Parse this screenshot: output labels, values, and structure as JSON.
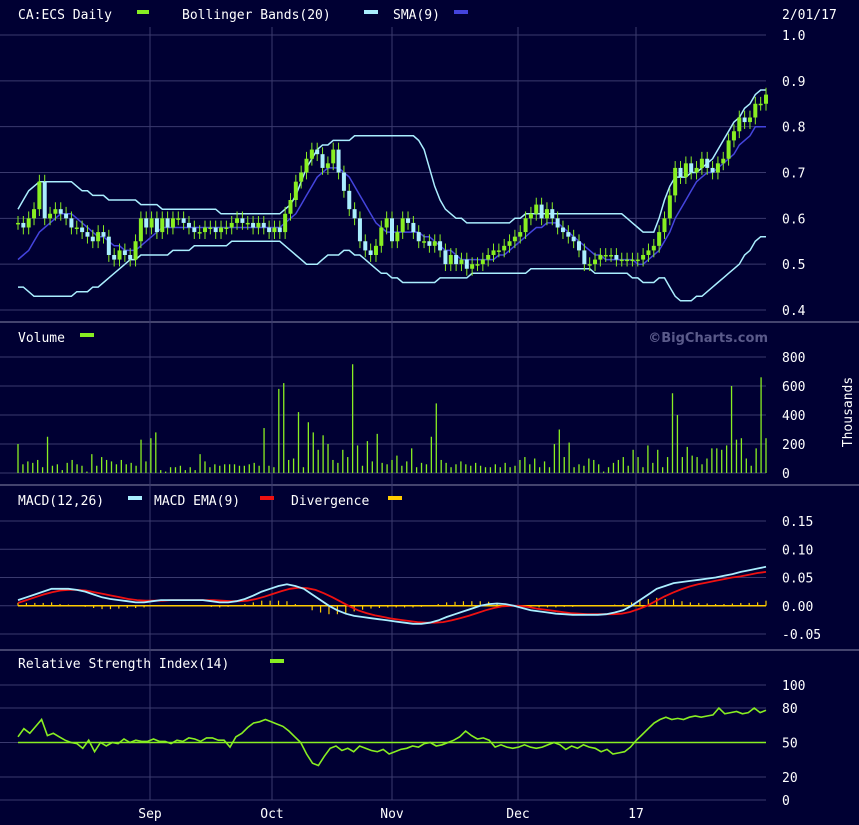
{
  "colors": {
    "background": "#000033",
    "grid": "#3a3a6e",
    "text": "#ffffff",
    "price": "#88ee22",
    "bollinger": "#aaeeff",
    "sma": "#4444dd",
    "volume": "#88ee22",
    "macd": "#aaeeff",
    "macd_ema": "#ee1111",
    "divergence": "#ffcc00",
    "rsi": "#88ee22"
  },
  "header": {
    "symbol_label": "CA:ECS Daily",
    "bollinger_label": "Bollinger Bands(20)",
    "sma_label": "SMA(9)",
    "date": "2/01/17"
  },
  "watermark": "©BigCharts.com",
  "x_labels": [
    "Sep",
    "Oct",
    "Nov",
    "Dec",
    "17"
  ],
  "chart_data": [
    {
      "type": "candlestick",
      "title": "CA:ECS Daily",
      "ylim": [
        0.4,
        1.0
      ],
      "yticks": [
        "1.0",
        "0.9",
        "0.8",
        "0.7",
        "0.6",
        "0.5",
        "0.4"
      ],
      "ytick_values": [
        1.0,
        0.9,
        0.8,
        0.7,
        0.6,
        0.5,
        0.4
      ],
      "close": [
        0.59,
        0.58,
        0.6,
        0.62,
        0.68,
        0.6,
        0.61,
        0.62,
        0.61,
        0.6,
        0.58,
        0.58,
        0.57,
        0.56,
        0.55,
        0.57,
        0.56,
        0.52,
        0.51,
        0.53,
        0.52,
        0.51,
        0.55,
        0.6,
        0.58,
        0.6,
        0.57,
        0.6,
        0.58,
        0.6,
        0.6,
        0.59,
        0.58,
        0.57,
        0.57,
        0.58,
        0.58,
        0.57,
        0.58,
        0.58,
        0.59,
        0.6,
        0.59,
        0.59,
        0.58,
        0.59,
        0.58,
        0.57,
        0.58,
        0.57,
        0.61,
        0.64,
        0.68,
        0.7,
        0.73,
        0.75,
        0.74,
        0.71,
        0.72,
        0.75,
        0.7,
        0.66,
        0.62,
        0.6,
        0.55,
        0.53,
        0.52,
        0.54,
        0.58,
        0.6,
        0.55,
        0.57,
        0.6,
        0.59,
        0.57,
        0.55,
        0.55,
        0.54,
        0.55,
        0.53,
        0.5,
        0.52,
        0.5,
        0.51,
        0.49,
        0.5,
        0.5,
        0.51,
        0.52,
        0.53,
        0.53,
        0.54,
        0.55,
        0.56,
        0.57,
        0.6,
        0.61,
        0.63,
        0.6,
        0.62,
        0.6,
        0.58,
        0.57,
        0.56,
        0.55,
        0.53,
        0.5,
        0.5,
        0.51,
        0.52,
        0.52,
        0.52,
        0.51,
        0.51,
        0.51,
        0.51,
        0.51,
        0.52,
        0.53,
        0.54,
        0.57,
        0.6,
        0.65,
        0.71,
        0.69,
        0.72,
        0.7,
        0.71,
        0.73,
        0.71,
        0.7,
        0.72,
        0.73,
        0.77,
        0.79,
        0.82,
        0.81,
        0.82,
        0.85,
        0.85,
        0.87
      ],
      "bollinger_upper": [
        0.62,
        0.64,
        0.66,
        0.67,
        0.68,
        0.68,
        0.68,
        0.68,
        0.68,
        0.68,
        0.68,
        0.67,
        0.66,
        0.66,
        0.65,
        0.65,
        0.65,
        0.64,
        0.64,
        0.64,
        0.64,
        0.64,
        0.64,
        0.63,
        0.63,
        0.63,
        0.63,
        0.62,
        0.62,
        0.62,
        0.62,
        0.62,
        0.62,
        0.62,
        0.62,
        0.62,
        0.62,
        0.62,
        0.61,
        0.61,
        0.61,
        0.61,
        0.61,
        0.61,
        0.61,
        0.61,
        0.61,
        0.61,
        0.61,
        0.61,
        0.62,
        0.63,
        0.65,
        0.68,
        0.71,
        0.73,
        0.75,
        0.76,
        0.76,
        0.77,
        0.77,
        0.77,
        0.77,
        0.78,
        0.78,
        0.78,
        0.78,
        0.78,
        0.78,
        0.78,
        0.78,
        0.78,
        0.78,
        0.78,
        0.78,
        0.77,
        0.75,
        0.71,
        0.67,
        0.64,
        0.62,
        0.61,
        0.6,
        0.6,
        0.59,
        0.59,
        0.59,
        0.59,
        0.59,
        0.59,
        0.59,
        0.59,
        0.59,
        0.6,
        0.6,
        0.61,
        0.61,
        0.61,
        0.61,
        0.61,
        0.61,
        0.61,
        0.61,
        0.61,
        0.61,
        0.61,
        0.61,
        0.61,
        0.61,
        0.61,
        0.61,
        0.61,
        0.61,
        0.61,
        0.6,
        0.59,
        0.58,
        0.57,
        0.57,
        0.57,
        0.6,
        0.64,
        0.67,
        0.69,
        0.69,
        0.69,
        0.7,
        0.7,
        0.71,
        0.72,
        0.73,
        0.75,
        0.77,
        0.79,
        0.81,
        0.82,
        0.84,
        0.85,
        0.87,
        0.88,
        0.88
      ],
      "bollinger_lower": [
        0.45,
        0.45,
        0.44,
        0.43,
        0.43,
        0.43,
        0.43,
        0.43,
        0.43,
        0.43,
        0.43,
        0.44,
        0.44,
        0.44,
        0.45,
        0.45,
        0.46,
        0.47,
        0.48,
        0.49,
        0.5,
        0.51,
        0.51,
        0.52,
        0.52,
        0.52,
        0.52,
        0.52,
        0.52,
        0.53,
        0.53,
        0.53,
        0.53,
        0.54,
        0.54,
        0.54,
        0.54,
        0.54,
        0.54,
        0.54,
        0.55,
        0.55,
        0.55,
        0.55,
        0.55,
        0.55,
        0.55,
        0.55,
        0.55,
        0.55,
        0.54,
        0.53,
        0.52,
        0.51,
        0.5,
        0.5,
        0.5,
        0.51,
        0.52,
        0.52,
        0.52,
        0.53,
        0.53,
        0.52,
        0.52,
        0.51,
        0.5,
        0.49,
        0.48,
        0.48,
        0.47,
        0.47,
        0.46,
        0.46,
        0.46,
        0.46,
        0.46,
        0.46,
        0.46,
        0.47,
        0.47,
        0.47,
        0.47,
        0.47,
        0.47,
        0.48,
        0.48,
        0.48,
        0.48,
        0.48,
        0.48,
        0.48,
        0.48,
        0.48,
        0.48,
        0.48,
        0.49,
        0.49,
        0.49,
        0.49,
        0.49,
        0.49,
        0.49,
        0.49,
        0.49,
        0.49,
        0.49,
        0.49,
        0.48,
        0.48,
        0.48,
        0.48,
        0.48,
        0.48,
        0.48,
        0.47,
        0.47,
        0.46,
        0.46,
        0.46,
        0.47,
        0.47,
        0.45,
        0.43,
        0.42,
        0.42,
        0.42,
        0.43,
        0.43,
        0.44,
        0.45,
        0.46,
        0.47,
        0.48,
        0.49,
        0.5,
        0.52,
        0.53,
        0.55,
        0.56,
        0.56
      ],
      "sma": [
        0.51,
        0.52,
        0.53,
        0.55,
        0.57,
        0.58,
        0.59,
        0.6,
        0.61,
        0.61,
        0.61,
        0.6,
        0.59,
        0.58,
        0.57,
        0.56,
        0.56,
        0.55,
        0.54,
        0.54,
        0.53,
        0.53,
        0.53,
        0.54,
        0.55,
        0.56,
        0.57,
        0.58,
        0.58,
        0.58,
        0.58,
        0.58,
        0.58,
        0.58,
        0.58,
        0.58,
        0.58,
        0.58,
        0.58,
        0.58,
        0.58,
        0.58,
        0.58,
        0.58,
        0.58,
        0.58,
        0.58,
        0.58,
        0.58,
        0.58,
        0.59,
        0.6,
        0.61,
        0.63,
        0.65,
        0.67,
        0.69,
        0.7,
        0.71,
        0.71,
        0.71,
        0.7,
        0.69,
        0.67,
        0.65,
        0.63,
        0.61,
        0.59,
        0.58,
        0.57,
        0.57,
        0.57,
        0.57,
        0.57,
        0.57,
        0.57,
        0.56,
        0.56,
        0.55,
        0.54,
        0.53,
        0.53,
        0.52,
        0.51,
        0.51,
        0.51,
        0.51,
        0.51,
        0.51,
        0.51,
        0.52,
        0.52,
        0.53,
        0.54,
        0.55,
        0.56,
        0.57,
        0.58,
        0.58,
        0.59,
        0.59,
        0.59,
        0.58,
        0.57,
        0.56,
        0.55,
        0.54,
        0.53,
        0.52,
        0.52,
        0.51,
        0.51,
        0.51,
        0.51,
        0.51,
        0.51,
        0.5,
        0.5,
        0.51,
        0.52,
        0.53,
        0.55,
        0.57,
        0.6,
        0.62,
        0.64,
        0.66,
        0.68,
        0.69,
        0.7,
        0.7,
        0.71,
        0.72,
        0.73,
        0.74,
        0.76,
        0.77,
        0.78,
        0.8,
        0.8,
        0.8
      ]
    },
    {
      "type": "bar",
      "title": "Volume",
      "ylabel": "Thousands",
      "ylim": [
        0,
        800
      ],
      "yticks": [
        "800",
        "600",
        "400",
        "200",
        "0"
      ],
      "ytick_values": [
        800,
        600,
        400,
        200,
        0
      ],
      "values": [
        200,
        60,
        80,
        70,
        90,
        40,
        250,
        50,
        60,
        20,
        70,
        90,
        60,
        50,
        10,
        130,
        50,
        110,
        90,
        80,
        60,
        90,
        60,
        70,
        50,
        230,
        80,
        240,
        280,
        20,
        10,
        40,
        40,
        50,
        20,
        40,
        20,
        130,
        80,
        40,
        60,
        50,
        60,
        60,
        60,
        50,
        50,
        60,
        70,
        50,
        310,
        50,
        40,
        580,
        620,
        90,
        100,
        420,
        40,
        350,
        280,
        160,
        260,
        200,
        90,
        70,
        160,
        110,
        750,
        190,
        50,
        220,
        80,
        270,
        70,
        60,
        90,
        120,
        50,
        80,
        170,
        40,
        70,
        60,
        250,
        480,
        90,
        70,
        40,
        60,
        80,
        60,
        50,
        70,
        50,
        40,
        40,
        60,
        40,
        70,
        40,
        50,
        90,
        110,
        60,
        100,
        40,
        80,
        40,
        200,
        300,
        110,
        210,
        40,
        60,
        50,
        100,
        90,
        60,
        10,
        40,
        70,
        90,
        110,
        50,
        160,
        110,
        40,
        190,
        70,
        160,
        40,
        110,
        550,
        400,
        110,
        180,
        120,
        110,
        60,
        100,
        170,
        170,
        160,
        190,
        600,
        230,
        240,
        100,
        50,
        170,
        660,
        240
      ],
      "volume_values_note_removed": true
    },
    {
      "type": "line",
      "title": "MACD(12,26)",
      "ylim": [
        -0.05,
        0.15
      ],
      "yticks": [
        "0.15",
        "0.10",
        "0.05",
        "0.00",
        "-0.05"
      ],
      "ytick_values": [
        0.15,
        0.1,
        0.05,
        0.0,
        -0.05
      ],
      "series": [
        {
          "name": "MACD(12,26)",
          "values": [
            0.01,
            0.015,
            0.02,
            0.025,
            0.03,
            0.03,
            0.03,
            0.028,
            0.025,
            0.02,
            0.015,
            0.012,
            0.01,
            0.008,
            0.006,
            0.006,
            0.008,
            0.01,
            0.01,
            0.01,
            0.01,
            0.01,
            0.01,
            0.008,
            0.006,
            0.006,
            0.008,
            0.012,
            0.018,
            0.025,
            0.03,
            0.035,
            0.038,
            0.035,
            0.03,
            0.02,
            0.01,
            0.0,
            -0.008,
            -0.014,
            -0.018,
            -0.02,
            -0.022,
            -0.024,
            -0.026,
            -0.028,
            -0.03,
            -0.032,
            -0.032,
            -0.03,
            -0.026,
            -0.02,
            -0.015,
            -0.01,
            -0.005,
            0.0,
            0.003,
            0.004,
            0.003,
            0.0,
            -0.004,
            -0.008,
            -0.01,
            -0.012,
            -0.014,
            -0.015,
            -0.016,
            -0.016,
            -0.016,
            -0.016,
            -0.015,
            -0.012,
            -0.008,
            0.0,
            0.01,
            0.02,
            0.03,
            0.035,
            0.04,
            0.042,
            0.044,
            0.046,
            0.048,
            0.05,
            0.053,
            0.056,
            0.06,
            0.063,
            0.066,
            0.069
          ]
        },
        {
          "name": "MACD EMA(9)",
          "values": [
            0.005,
            0.01,
            0.015,
            0.02,
            0.024,
            0.027,
            0.028,
            0.028,
            0.027,
            0.024,
            0.021,
            0.018,
            0.015,
            0.012,
            0.01,
            0.009,
            0.009,
            0.009,
            0.01,
            0.01,
            0.01,
            0.01,
            0.01,
            0.01,
            0.009,
            0.008,
            0.008,
            0.009,
            0.012,
            0.016,
            0.021,
            0.026,
            0.03,
            0.032,
            0.031,
            0.028,
            0.022,
            0.015,
            0.007,
            -0.001,
            -0.008,
            -0.013,
            -0.017,
            -0.02,
            -0.023,
            -0.025,
            -0.027,
            -0.029,
            -0.03,
            -0.03,
            -0.029,
            -0.026,
            -0.022,
            -0.018,
            -0.013,
            -0.008,
            -0.004,
            -0.001,
            0.0,
            0.0,
            -0.002,
            -0.005,
            -0.007,
            -0.009,
            -0.011,
            -0.013,
            -0.014,
            -0.015,
            -0.015,
            -0.015,
            -0.015,
            -0.014,
            -0.011,
            -0.006,
            0.0,
            0.008,
            0.016,
            0.023,
            0.029,
            0.034,
            0.038,
            0.041,
            0.044,
            0.047,
            0.05,
            0.052,
            0.055,
            0.058,
            0.06
          ]
        },
        {
          "name": "Divergence",
          "values": [
            0.005,
            0.005,
            0.005,
            0.005,
            0.006,
            0.003,
            0.002,
            0.0,
            -0.002,
            -0.004,
            -0.006,
            -0.006,
            -0.005,
            -0.004,
            -0.004,
            -0.003,
            -0.001,
            0.001,
            0.0,
            0.0,
            0.0,
            0.0,
            0.0,
            -0.002,
            -0.003,
            -0.002,
            0.0,
            0.003,
            0.006,
            0.009,
            0.009,
            0.009,
            0.008,
            0.003,
            -0.001,
            -0.008,
            -0.012,
            -0.015,
            -0.015,
            -0.013,
            -0.01,
            -0.007,
            -0.005,
            -0.004,
            -0.003,
            -0.003,
            -0.003,
            -0.003,
            -0.002,
            0.0,
            0.003,
            0.006,
            0.007,
            0.008,
            0.008,
            0.008,
            0.007,
            0.005,
            0.003,
            0.0,
            -0.002,
            -0.003,
            -0.003,
            -0.003,
            -0.003,
            -0.002,
            -0.002,
            -0.001,
            -0.001,
            -0.001,
            0.0,
            0.002,
            0.003,
            0.006,
            0.01,
            0.012,
            0.014,
            0.012,
            0.011,
            0.008,
            0.006,
            0.005,
            0.004,
            0.003,
            0.003,
            0.004,
            0.005,
            0.005,
            0.006,
            0.009
          ]
        }
      ],
      "legend": [
        "MACD(12,26)",
        "MACD EMA(9)",
        "Divergence"
      ]
    },
    {
      "type": "line",
      "title": "Relative Strength Index(14)",
      "ylim": [
        0,
        100
      ],
      "yticks": [
        "100",
        "80",
        "50",
        "20",
        "0"
      ],
      "ytick_values": [
        100,
        80,
        50,
        20,
        0
      ],
      "reference_line": 50,
      "series": [
        {
          "name": "Relative Strength Index(14)",
          "values": [
            55,
            62,
            58,
            64,
            70,
            56,
            58,
            55,
            52,
            50,
            49,
            45,
            52,
            42,
            50,
            47,
            50,
            49,
            53,
            50,
            52,
            51,
            51,
            53,
            51,
            51,
            49,
            52,
            51,
            54,
            53,
            51,
            54,
            54,
            52,
            52,
            46,
            55,
            58,
            63,
            67,
            68,
            70,
            68,
            66,
            64,
            60,
            55,
            50,
            40,
            32,
            30,
            38,
            45,
            47,
            43,
            45,
            42,
            47,
            45,
            43,
            42,
            44,
            40,
            42,
            44,
            45,
            47,
            46,
            49,
            50,
            47,
            48,
            50,
            52,
            55,
            60,
            56,
            53,
            54,
            52,
            46,
            48,
            46,
            45,
            46,
            48,
            46,
            45,
            46,
            48,
            50,
            48,
            44,
            47,
            45,
            48,
            46,
            45,
            42,
            44,
            40,
            41,
            42,
            46,
            52,
            57,
            62,
            67,
            70,
            72,
            70,
            71,
            70,
            72,
            73,
            72,
            73,
            74,
            80,
            75,
            76,
            77,
            75,
            76,
            80,
            76,
            78
          ]
        }
      ]
    }
  ],
  "legends": {
    "volume": "Volume",
    "macd": "MACD(12,26)",
    "macd_ema": "MACD EMA(9)",
    "divergence": "Divergence",
    "rsi": "Relative Strength Index(14)",
    "thousands": "Thousands"
  }
}
